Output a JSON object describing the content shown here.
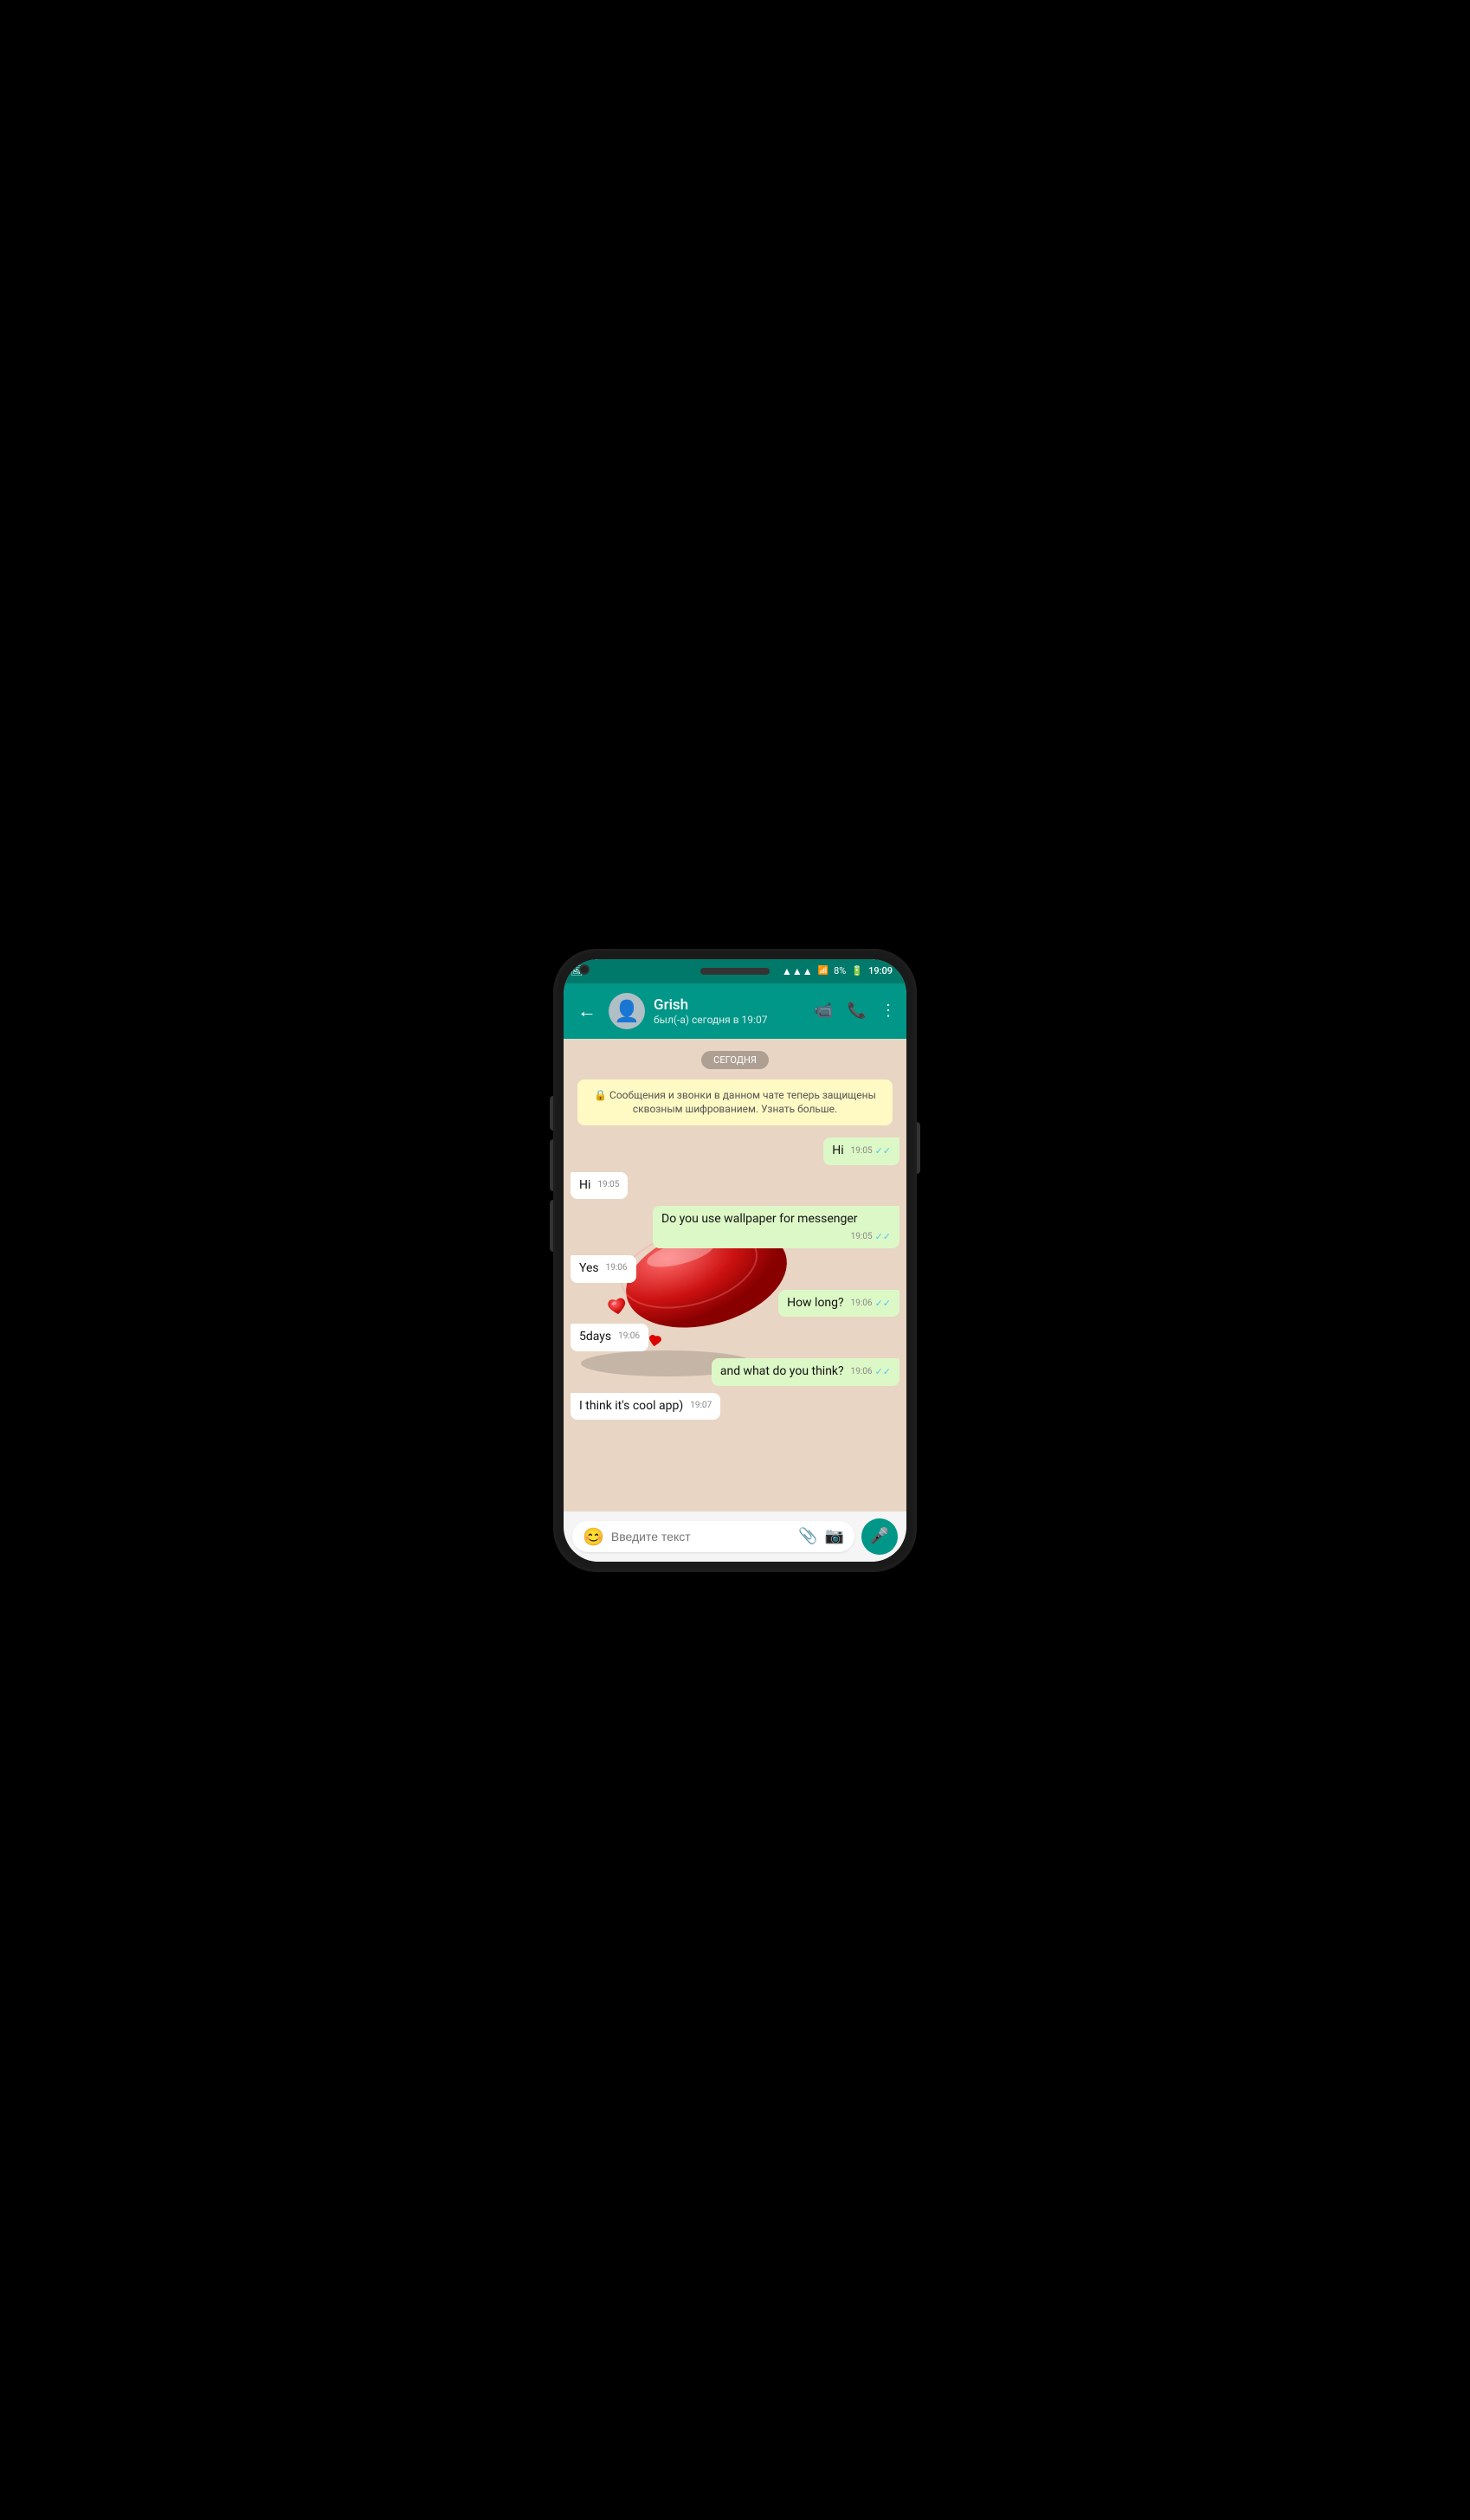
{
  "phone": {
    "status_bar": {
      "time": "19:09",
      "battery": "8%",
      "wifi": "wifi",
      "signal": "signal"
    },
    "app_bar": {
      "back_label": "←",
      "contact_name": "Grish",
      "contact_status": "был(-а) сегодня в 19:07",
      "video_call_icon": "video-camera",
      "phone_icon": "phone",
      "more_icon": "more-vertical"
    },
    "chat": {
      "date_badge": "СЕГОДНЯ",
      "system_message": "🔒 Сообщения и звонки в данном чате теперь защищены сквозным шифрованием. Узнать больше.",
      "messages": [
        {
          "id": 1,
          "type": "sent",
          "text": "Hi",
          "time": "19:05",
          "status": "read"
        },
        {
          "id": 2,
          "type": "received",
          "text": "Hi",
          "time": "19:05"
        },
        {
          "id": 3,
          "type": "sent",
          "text": "Do you use wallpaper for messenger",
          "time": "19:05",
          "status": "read"
        },
        {
          "id": 4,
          "type": "received",
          "text": "Yes",
          "time": "19:06"
        },
        {
          "id": 5,
          "type": "sent",
          "text": "How long?",
          "time": "19:06",
          "status": "read"
        },
        {
          "id": 6,
          "type": "received",
          "text": "5days",
          "time": "19:06"
        },
        {
          "id": 7,
          "type": "sent",
          "text": "and what do you think?",
          "time": "19:06",
          "status": "read"
        },
        {
          "id": 8,
          "type": "received",
          "text": "I think it's cool app)",
          "time": "19:07"
        }
      ]
    },
    "input_bar": {
      "placeholder": "Введите текст",
      "emoji_icon": "😊",
      "attach_icon": "📎",
      "camera_icon": "📷",
      "mic_icon": "🎤"
    }
  }
}
